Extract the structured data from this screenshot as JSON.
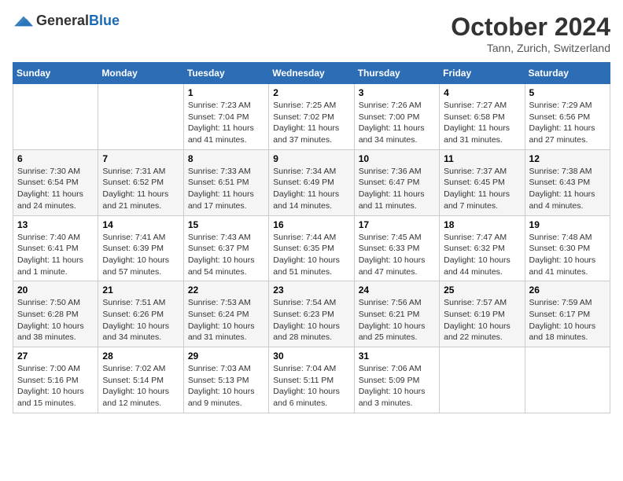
{
  "logo": {
    "general": "General",
    "blue": "Blue"
  },
  "title": {
    "month": "October 2024",
    "location": "Tann, Zurich, Switzerland"
  },
  "headers": [
    "Sunday",
    "Monday",
    "Tuesday",
    "Wednesday",
    "Thursday",
    "Friday",
    "Saturday"
  ],
  "weeks": [
    [
      {
        "day": "",
        "detail": ""
      },
      {
        "day": "",
        "detail": ""
      },
      {
        "day": "1",
        "detail": "Sunrise: 7:23 AM\nSunset: 7:04 PM\nDaylight: 11 hours and 41 minutes."
      },
      {
        "day": "2",
        "detail": "Sunrise: 7:25 AM\nSunset: 7:02 PM\nDaylight: 11 hours and 37 minutes."
      },
      {
        "day": "3",
        "detail": "Sunrise: 7:26 AM\nSunset: 7:00 PM\nDaylight: 11 hours and 34 minutes."
      },
      {
        "day": "4",
        "detail": "Sunrise: 7:27 AM\nSunset: 6:58 PM\nDaylight: 11 hours and 31 minutes."
      },
      {
        "day": "5",
        "detail": "Sunrise: 7:29 AM\nSunset: 6:56 PM\nDaylight: 11 hours and 27 minutes."
      }
    ],
    [
      {
        "day": "6",
        "detail": "Sunrise: 7:30 AM\nSunset: 6:54 PM\nDaylight: 11 hours and 24 minutes."
      },
      {
        "day": "7",
        "detail": "Sunrise: 7:31 AM\nSunset: 6:52 PM\nDaylight: 11 hours and 21 minutes."
      },
      {
        "day": "8",
        "detail": "Sunrise: 7:33 AM\nSunset: 6:51 PM\nDaylight: 11 hours and 17 minutes."
      },
      {
        "day": "9",
        "detail": "Sunrise: 7:34 AM\nSunset: 6:49 PM\nDaylight: 11 hours and 14 minutes."
      },
      {
        "day": "10",
        "detail": "Sunrise: 7:36 AM\nSunset: 6:47 PM\nDaylight: 11 hours and 11 minutes."
      },
      {
        "day": "11",
        "detail": "Sunrise: 7:37 AM\nSunset: 6:45 PM\nDaylight: 11 hours and 7 minutes."
      },
      {
        "day": "12",
        "detail": "Sunrise: 7:38 AM\nSunset: 6:43 PM\nDaylight: 11 hours and 4 minutes."
      }
    ],
    [
      {
        "day": "13",
        "detail": "Sunrise: 7:40 AM\nSunset: 6:41 PM\nDaylight: 11 hours and 1 minute."
      },
      {
        "day": "14",
        "detail": "Sunrise: 7:41 AM\nSunset: 6:39 PM\nDaylight: 10 hours and 57 minutes."
      },
      {
        "day": "15",
        "detail": "Sunrise: 7:43 AM\nSunset: 6:37 PM\nDaylight: 10 hours and 54 minutes."
      },
      {
        "day": "16",
        "detail": "Sunrise: 7:44 AM\nSunset: 6:35 PM\nDaylight: 10 hours and 51 minutes."
      },
      {
        "day": "17",
        "detail": "Sunrise: 7:45 AM\nSunset: 6:33 PM\nDaylight: 10 hours and 47 minutes."
      },
      {
        "day": "18",
        "detail": "Sunrise: 7:47 AM\nSunset: 6:32 PM\nDaylight: 10 hours and 44 minutes."
      },
      {
        "day": "19",
        "detail": "Sunrise: 7:48 AM\nSunset: 6:30 PM\nDaylight: 10 hours and 41 minutes."
      }
    ],
    [
      {
        "day": "20",
        "detail": "Sunrise: 7:50 AM\nSunset: 6:28 PM\nDaylight: 10 hours and 38 minutes."
      },
      {
        "day": "21",
        "detail": "Sunrise: 7:51 AM\nSunset: 6:26 PM\nDaylight: 10 hours and 34 minutes."
      },
      {
        "day": "22",
        "detail": "Sunrise: 7:53 AM\nSunset: 6:24 PM\nDaylight: 10 hours and 31 minutes."
      },
      {
        "day": "23",
        "detail": "Sunrise: 7:54 AM\nSunset: 6:23 PM\nDaylight: 10 hours and 28 minutes."
      },
      {
        "day": "24",
        "detail": "Sunrise: 7:56 AM\nSunset: 6:21 PM\nDaylight: 10 hours and 25 minutes."
      },
      {
        "day": "25",
        "detail": "Sunrise: 7:57 AM\nSunset: 6:19 PM\nDaylight: 10 hours and 22 minutes."
      },
      {
        "day": "26",
        "detail": "Sunrise: 7:59 AM\nSunset: 6:17 PM\nDaylight: 10 hours and 18 minutes."
      }
    ],
    [
      {
        "day": "27",
        "detail": "Sunrise: 7:00 AM\nSunset: 5:16 PM\nDaylight: 10 hours and 15 minutes."
      },
      {
        "day": "28",
        "detail": "Sunrise: 7:02 AM\nSunset: 5:14 PM\nDaylight: 10 hours and 12 minutes."
      },
      {
        "day": "29",
        "detail": "Sunrise: 7:03 AM\nSunset: 5:13 PM\nDaylight: 10 hours and 9 minutes."
      },
      {
        "day": "30",
        "detail": "Sunrise: 7:04 AM\nSunset: 5:11 PM\nDaylight: 10 hours and 6 minutes."
      },
      {
        "day": "31",
        "detail": "Sunrise: 7:06 AM\nSunset: 5:09 PM\nDaylight: 10 hours and 3 minutes."
      },
      {
        "day": "",
        "detail": ""
      },
      {
        "day": "",
        "detail": ""
      }
    ]
  ]
}
